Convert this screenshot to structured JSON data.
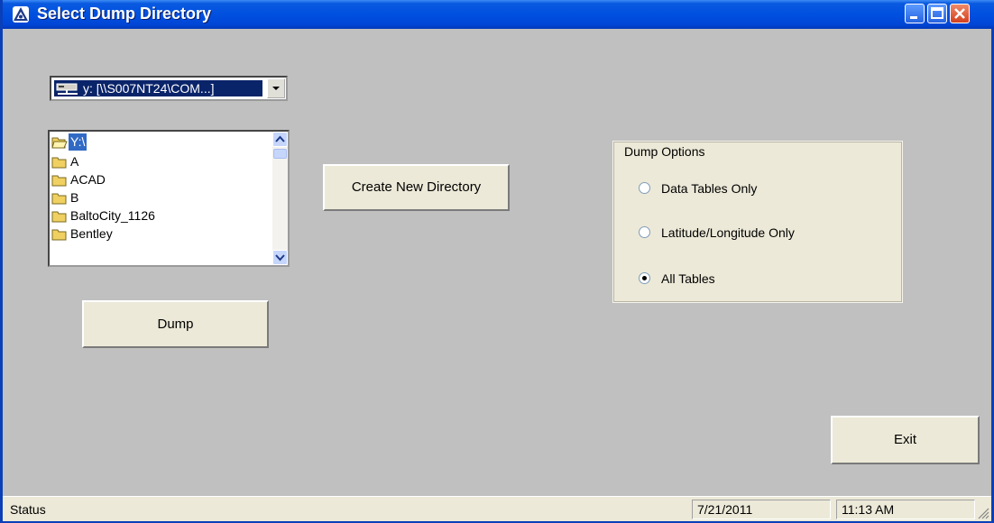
{
  "window": {
    "title": "Select Dump Directory",
    "icon": "app-shield-icon"
  },
  "titlebar_buttons": {
    "minimize": "minimize-icon",
    "maximize": "maximize-icon",
    "close": "close-icon"
  },
  "drive_combo": {
    "selected": "y: [\\\\S007NT24\\COM...]",
    "icon": "network-drive-icon"
  },
  "directory_list": {
    "items": [
      {
        "label": "Y:\\",
        "selected": true,
        "icon": "open-folder-icon"
      },
      {
        "label": "A",
        "icon": "folder-icon"
      },
      {
        "label": "ACAD",
        "icon": "folder-icon"
      },
      {
        "label": "B",
        "icon": "folder-icon"
      },
      {
        "label": "BaltoCity_1126",
        "icon": "folder-icon"
      },
      {
        "label": "Bentley",
        "icon": "folder-icon"
      }
    ]
  },
  "buttons": {
    "create_directory": "Create New Directory",
    "dump": "Dump",
    "exit": "Exit"
  },
  "dump_options": {
    "title": "Dump Options",
    "options": [
      {
        "label": "Data Tables Only",
        "checked": false
      },
      {
        "label": "Latitude/Longitude Only",
        "checked": false
      },
      {
        "label": "All Tables",
        "checked": true
      }
    ]
  },
  "status_bar": {
    "status": "Status",
    "date": "7/21/2011",
    "time": "11:13 AM"
  },
  "colors": {
    "titlebar": "#0050e0",
    "dialog_bg": "#c0c0c0",
    "selection": "#316ac5",
    "control_face": "#ece9d8"
  }
}
